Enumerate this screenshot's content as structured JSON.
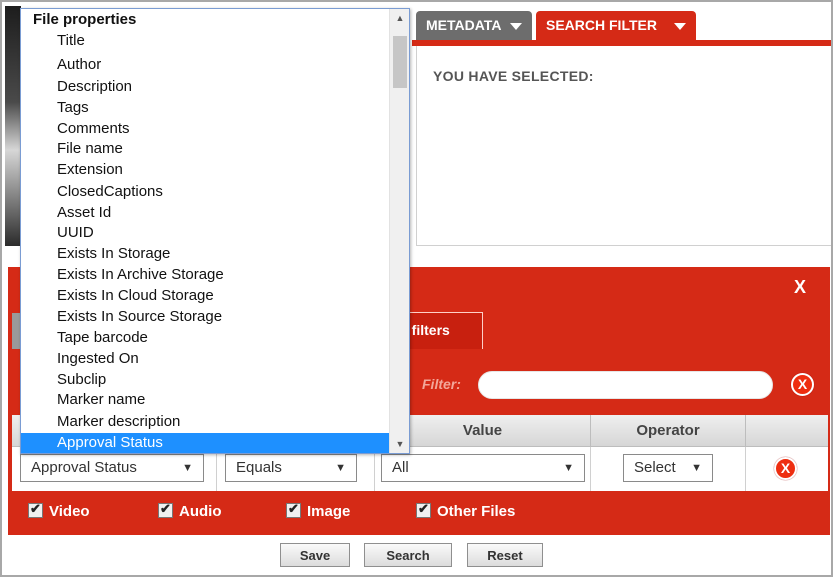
{
  "tabs": {
    "metadata": "METADATA",
    "search_filter": "SEARCH FILTER"
  },
  "selected_panel": {
    "title": "YOU HAVE SELECTED:"
  },
  "modal": {
    "close": "X",
    "active_tab_fragment": "e filters",
    "filter_label": "Filter:",
    "filter_value": "",
    "clear_symbol": "X"
  },
  "grid": {
    "headers": [
      "Value",
      "Operator"
    ],
    "row": {
      "property": "Approval Status",
      "condition": "Equals",
      "value": "All",
      "operator": "Select",
      "remove_symbol": "X"
    }
  },
  "media_types": [
    {
      "label": "Video",
      "checked": true
    },
    {
      "label": "Audio",
      "checked": true
    },
    {
      "label": "Image",
      "checked": true
    },
    {
      "label": "Other Files",
      "checked": true
    }
  ],
  "actions": {
    "save": "Save",
    "search": "Search",
    "reset": "Reset"
  },
  "dropdown": {
    "group_label": "File properties",
    "options": [
      "Title",
      "Author",
      "Description",
      "Tags",
      "Comments",
      "File name",
      "Extension",
      "ClosedCaptions",
      "Asset Id",
      "UUID",
      "Exists In Storage",
      "Exists In Archive Storage",
      "Exists In Cloud Storage",
      "Exists In Source Storage",
      "Tape barcode",
      "Ingested On",
      "Subclip",
      "Marker name",
      "Marker description",
      "Approval Status"
    ],
    "selected": "Approval Status"
  },
  "icons": {
    "dropdown_caret": "caret-down-icon",
    "remove": "remove-circle-icon",
    "check": "checkmark-icon"
  },
  "colors": {
    "brand_red": "#d52a16",
    "selection_blue": "#1e90ff",
    "tab_grey": "#6d6d6d"
  }
}
